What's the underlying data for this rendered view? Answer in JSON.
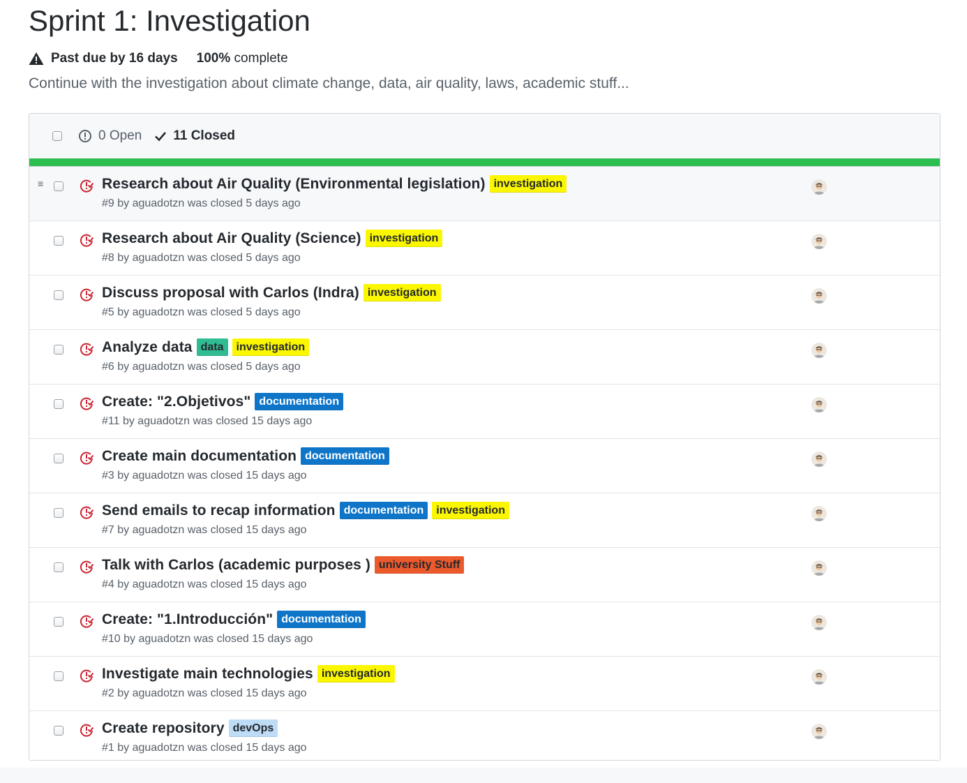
{
  "milestone": {
    "title": "Sprint 1: Investigation",
    "past_due": "Past due by 16 days",
    "percent": "100%",
    "percent_suffix": "complete",
    "description": "Continue with the investigation about climate change, data, air quality, laws, academic stuff..."
  },
  "header": {
    "open_label": "0 Open",
    "closed_label": "11 Closed"
  },
  "progress": {
    "fraction": 1.0,
    "color": "#2cbe4e"
  },
  "labels": {
    "investigation": {
      "text": "investigation",
      "bg": "#fbf700",
      "fg": "#24292e"
    },
    "data": {
      "text": "data",
      "bg": "#2fbc93",
      "fg": "#24292e"
    },
    "documentation": {
      "text": "documentation",
      "bg": "#0e75c9",
      "fg": "#ffffff"
    },
    "university": {
      "text": "university Stuff",
      "bg": "#ec5a2c",
      "fg": "#24292e"
    },
    "devops": {
      "text": "devOps",
      "bg": "#bfdcf6",
      "fg": "#24292e"
    }
  },
  "issues": [
    {
      "title": "Research about Air Quality (Environmental legislation)",
      "labels": [
        "investigation"
      ],
      "meta": "#9 by aguadotzn was closed 5 days ago"
    },
    {
      "title": "Research about Air Quality (Science)",
      "labels": [
        "investigation"
      ],
      "meta": "#8 by aguadotzn was closed 5 days ago"
    },
    {
      "title": "Discuss proposal with Carlos (Indra)",
      "labels": [
        "investigation"
      ],
      "meta": "#5 by aguadotzn was closed 5 days ago"
    },
    {
      "title": "Analyze data",
      "labels": [
        "data",
        "investigation"
      ],
      "meta": "#6 by aguadotzn was closed 5 days ago"
    },
    {
      "title": "Create: \"2.Objetivos\"",
      "labels": [
        "documentation"
      ],
      "meta": "#11 by aguadotzn was closed 15 days ago"
    },
    {
      "title": "Create main documentation",
      "labels": [
        "documentation"
      ],
      "meta": "#3 by aguadotzn was closed 15 days ago"
    },
    {
      "title": "Send emails to recap information",
      "labels": [
        "documentation",
        "investigation"
      ],
      "meta": "#7 by aguadotzn was closed 15 days ago"
    },
    {
      "title": "Talk with Carlos (academic purposes )",
      "labels": [
        "university"
      ],
      "meta": "#4 by aguadotzn was closed 15 days ago"
    },
    {
      "title": "Create: \"1.Introducción\"",
      "labels": [
        "documentation"
      ],
      "meta": "#10 by aguadotzn was closed 15 days ago"
    },
    {
      "title": "Investigate main technologies",
      "labels": [
        "investigation"
      ],
      "meta": "#2 by aguadotzn was closed 15 days ago"
    },
    {
      "title": "Create repository",
      "labels": [
        "devops"
      ],
      "meta": "#1 by aguadotzn was closed 15 days ago"
    }
  ],
  "icons": {
    "warning": "alert-icon",
    "open": "issue-opened-icon",
    "closed": "check-icon",
    "issue_closed": "issue-closed-icon",
    "drag": "drag-handle-icon",
    "avatar": "avatar"
  }
}
